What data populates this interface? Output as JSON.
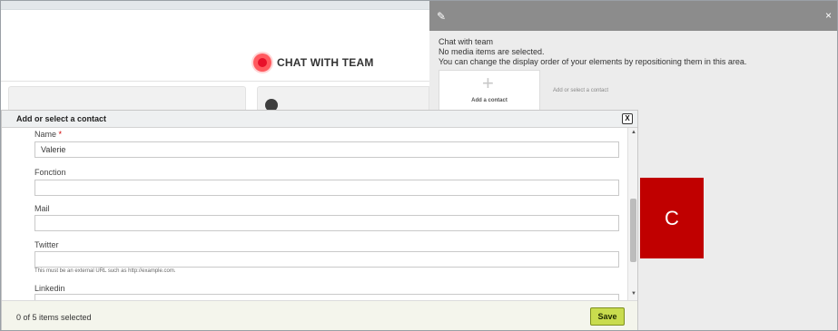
{
  "background": {
    "section_title": "CHAT WITH TEAM"
  },
  "side_panel": {
    "title": "Chat with team",
    "no_media": "No media items are selected.",
    "instructions": "You can change the display order of your elements by repositioning them in this area.",
    "add_tile_label": "Add a contact",
    "add_hint": "Add or select a contact",
    "close_icon": "×",
    "pencil_icon": "✎"
  },
  "modal": {
    "title": "Add or select a contact",
    "close_label": "X",
    "fields": {
      "name": {
        "label": "Name",
        "required_mark": "*",
        "value": "Valerie"
      },
      "fonction": {
        "label": "Fonction",
        "value": ""
      },
      "mail": {
        "label": "Mail",
        "value": ""
      },
      "twitter": {
        "label": "Twitter",
        "value": "",
        "help": "This must be an external URL such as http://example.com."
      },
      "linkedin": {
        "label": "Linkedin",
        "value": ""
      }
    },
    "footer": {
      "status": "0 of 5 items selected",
      "save_label": "Save"
    }
  },
  "annotation": {
    "letter": "C",
    "color": "#c00000"
  },
  "colors": {
    "save_button": "#c9dc4e",
    "side_header": "#8c8c8c",
    "accent_red": "#e8102a"
  }
}
